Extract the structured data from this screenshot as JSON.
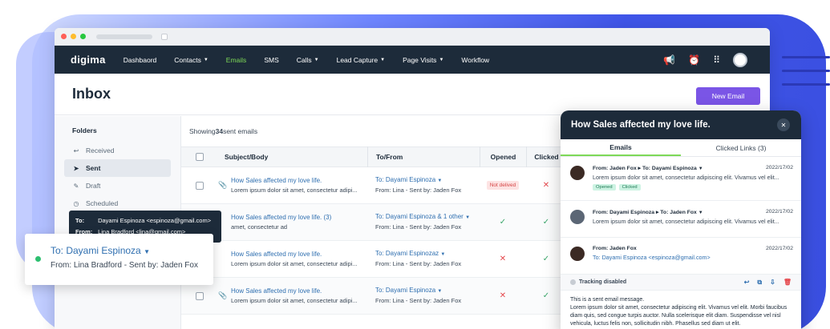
{
  "nav": {
    "logo": "digima",
    "items": [
      {
        "label": "Dashbaord",
        "caret": false,
        "active": false
      },
      {
        "label": "Contacts",
        "caret": true,
        "active": false
      },
      {
        "label": "Emails",
        "caret": false,
        "active": true
      },
      {
        "label": "SMS",
        "caret": false,
        "active": false
      },
      {
        "label": "Calls",
        "caret": true,
        "active": false
      },
      {
        "label": "Lead Capture",
        "caret": true,
        "active": false
      },
      {
        "label": "Page Visits",
        "caret": true,
        "active": false
      },
      {
        "label": "Workflow",
        "caret": false,
        "active": false
      }
    ]
  },
  "page": {
    "title": "Inbox",
    "new_email": "New Email"
  },
  "sidebar": {
    "heading": "Folders",
    "items": [
      {
        "label": "Received",
        "icon": "reply-icon"
      },
      {
        "label": "Sent",
        "icon": "send-icon",
        "selected": true
      },
      {
        "label": "Draft",
        "icon": "pencil-icon"
      },
      {
        "label": "Scheduled",
        "icon": "clock-icon"
      }
    ]
  },
  "table": {
    "showing_prefix": "Showing ",
    "showing_count": "34",
    "showing_suffix": " sent emails",
    "headers": {
      "subject": "Subject/Body",
      "to": "To/From",
      "opened": "Opened",
      "clicked": "Clicked"
    },
    "rows": [
      {
        "subject": "How Sales affected my love life.",
        "body": "Lorem ipsum dolor sit amet, consectetur adipi...",
        "to": "To: Dayami Espinoza",
        "from": "From: Lina - Sent by: Jaden Fox",
        "opened": "Not delived",
        "clicked": "✕",
        "clip": true
      },
      {
        "subject": "How Sales affected my love life. (3)",
        "body": "amet, consectetur ad",
        "to": "To: Dayami Espinoza & 1 other",
        "from": "From: Lina - Sent by: Jaden Fox",
        "opened": "✓",
        "clicked": "✓",
        "clip": false
      },
      {
        "subject": "How Sales affected my love life.",
        "body": "Lorem ipsum dolor sit amet, consectetur adipi...",
        "to": "To: Dayami Espinozaz",
        "from": "From: Lina - Sent by: Jaden Fox",
        "opened": "✕",
        "clicked": "✓",
        "clip": false
      },
      {
        "subject": "How Sales affected my love life.",
        "body": "Lorem ipsum dolor sit amet, consectetur adipi...",
        "to": "To: Dayami Espinoza",
        "from": "From: Lina - Sent by: Jaden Fox",
        "opened": "✕",
        "clicked": "✓",
        "clip": true
      }
    ]
  },
  "tooltip": {
    "to_label": "To:",
    "to_value": "Dayami Espinoza <espinoza@gmail.com>",
    "from_label": "From:",
    "from_value": "Lina Bradford <lina@gmail.com>"
  },
  "card": {
    "to": "To: Dayami Espinoza",
    "from": "From: Lina Bradford - Sent by: Jaden Fox"
  },
  "panel": {
    "title": "How Sales affected my love life.",
    "tabs": [
      "Emails",
      "Clicked Links (3)"
    ],
    "messages": [
      {
        "from": "From: Jaden Fox",
        "to": "To: Dayami Espinoza",
        "date": "2022/17/02",
        "body": "Lorem ipsum dolor sit amet, consectetur adipiscing elit. Vivamus vel elit...",
        "tags": [
          "Opened",
          "Clicked"
        ]
      },
      {
        "from": "From: Dayami Espinoza",
        "to": "To: Jaden Fox",
        "date": "2022/17/02",
        "body": "Lorem ipsum dolor sit amet, consectetur adipiscing elit. Vivamus vel elit..."
      },
      {
        "from": "From: Jaden Fox",
        "date": "2022/17/02",
        "to_line": "To: Dayami Espinoza <espinoza@gmail.com>"
      }
    ],
    "tracking": "Tracking disabled",
    "body_intro": "This is a sent email message.",
    "body_text": "Lorem ipsum dolor sit amet, consectetur adipiscing elit. Vivamus vel elit. Morbi faucibus diam quis, sed congue turpis auctor. Nulla scelerisque elit diam. Suspendisse vel nisl vehicula, luctus felis non, sollicitudin nibh. Phasellus sed diam ut elit."
  }
}
